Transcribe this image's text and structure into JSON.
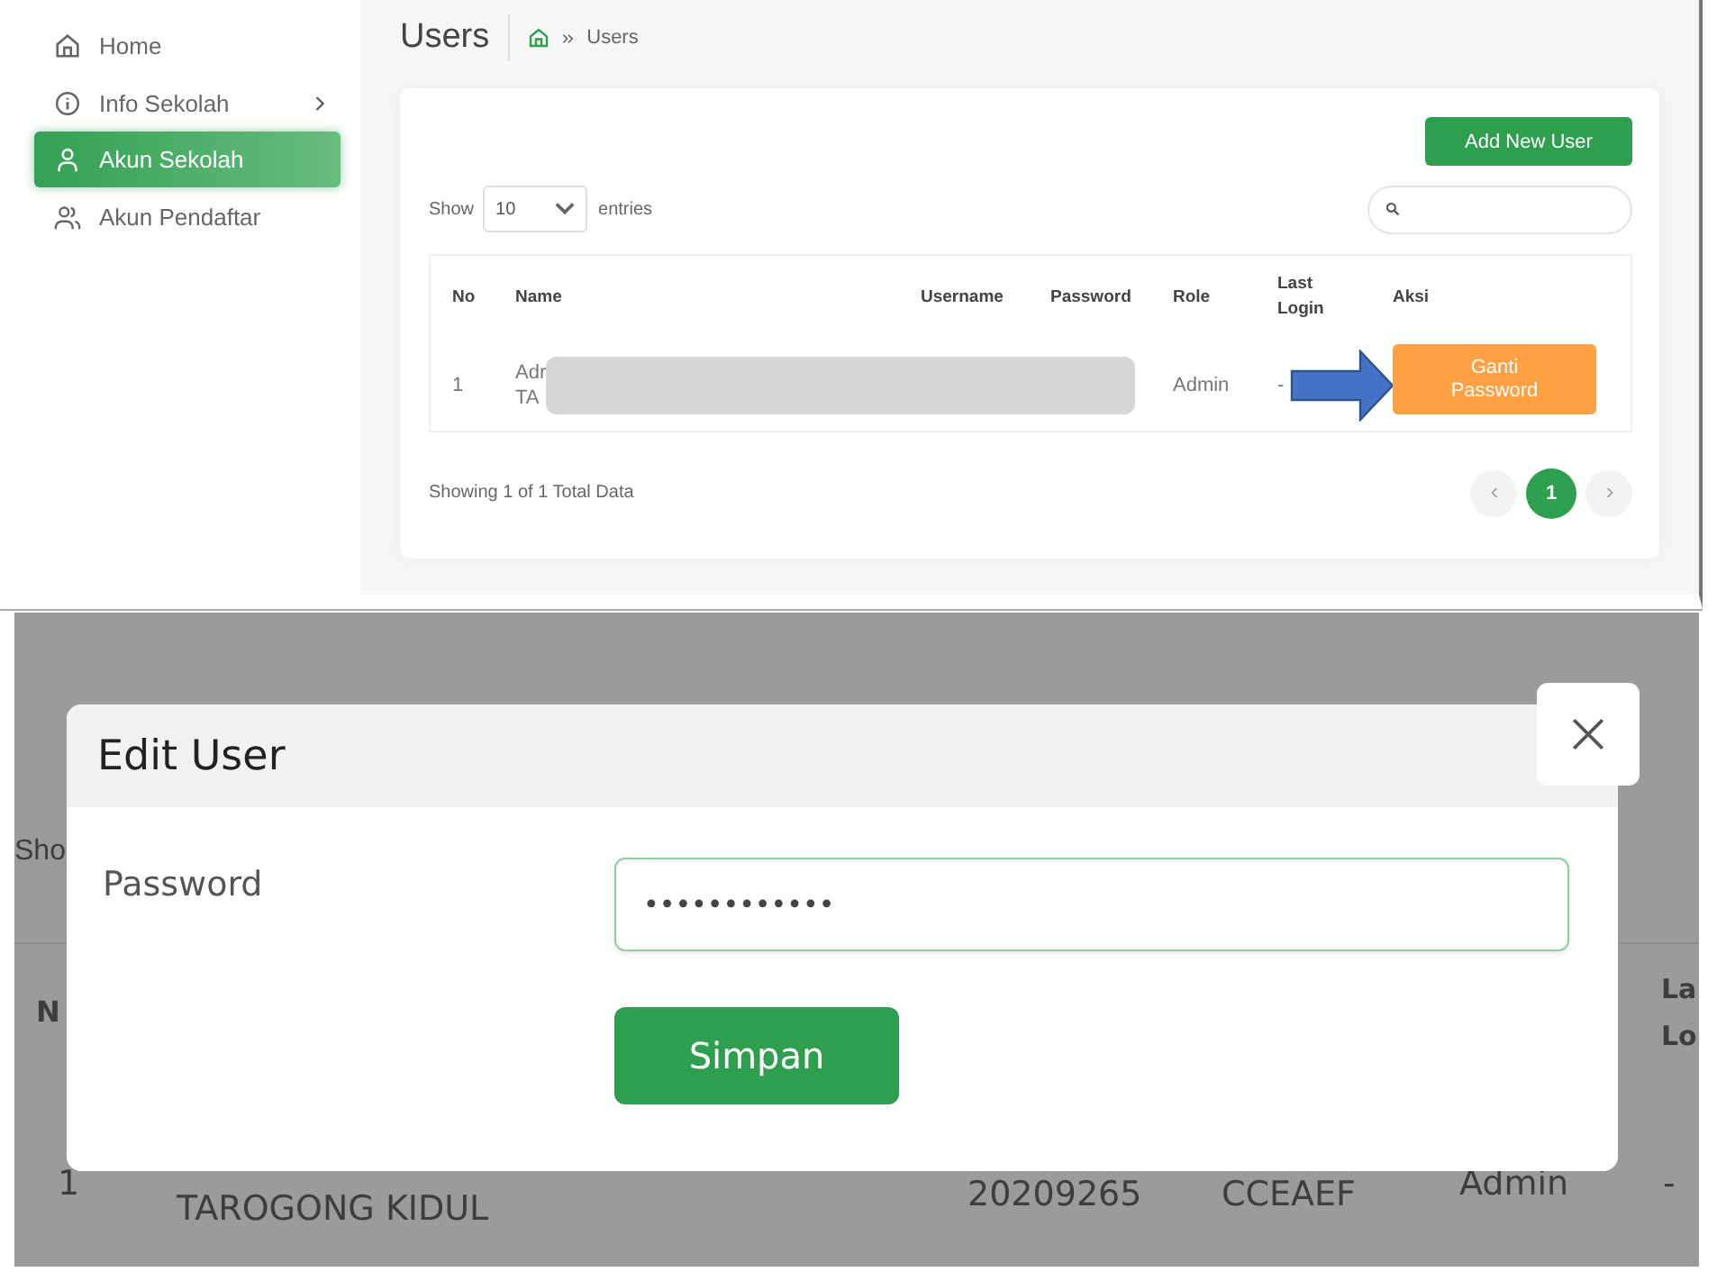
{
  "sidebar": {
    "items": [
      {
        "label": "Home",
        "selected": false,
        "expandable": false
      },
      {
        "label": "Info Sekolah",
        "selected": false,
        "expandable": true
      },
      {
        "label": "Akun Sekolah",
        "selected": true,
        "expandable": false
      },
      {
        "label": "Akun Pendaftar",
        "selected": false,
        "expandable": false
      }
    ]
  },
  "page": {
    "title": "Users",
    "breadcrumb": "Users"
  },
  "card": {
    "add_button": "Add New User",
    "show_label": "Show",
    "page_size": "10",
    "entries_label": "entries",
    "columns": [
      "No",
      "Name",
      "Username",
      "Password",
      "Role",
      "Last Login",
      "Aksi"
    ],
    "rows": [
      {
        "no": "1",
        "name_lines": [
          "Adr",
          "TA"
        ],
        "role": "Admin",
        "last_login": "-",
        "action": "Ganti Password"
      }
    ],
    "summary": "Showing 1 of 1 Total Data",
    "pages": [
      {
        "label": "1",
        "selected": true
      }
    ]
  },
  "background": {
    "show_fragment": "Sho",
    "header_fragments": [
      "N",
      "La",
      "Lo"
    ],
    "row": {
      "no": "1",
      "name": "TAROGONG KIDUL",
      "username": "20209265",
      "password": "CCEAEF",
      "role": "Admin",
      "last_login": "-"
    }
  },
  "modal": {
    "title": "Edit User",
    "field_label": "Password",
    "value": "••••••••••••",
    "button": "Simpan"
  }
}
